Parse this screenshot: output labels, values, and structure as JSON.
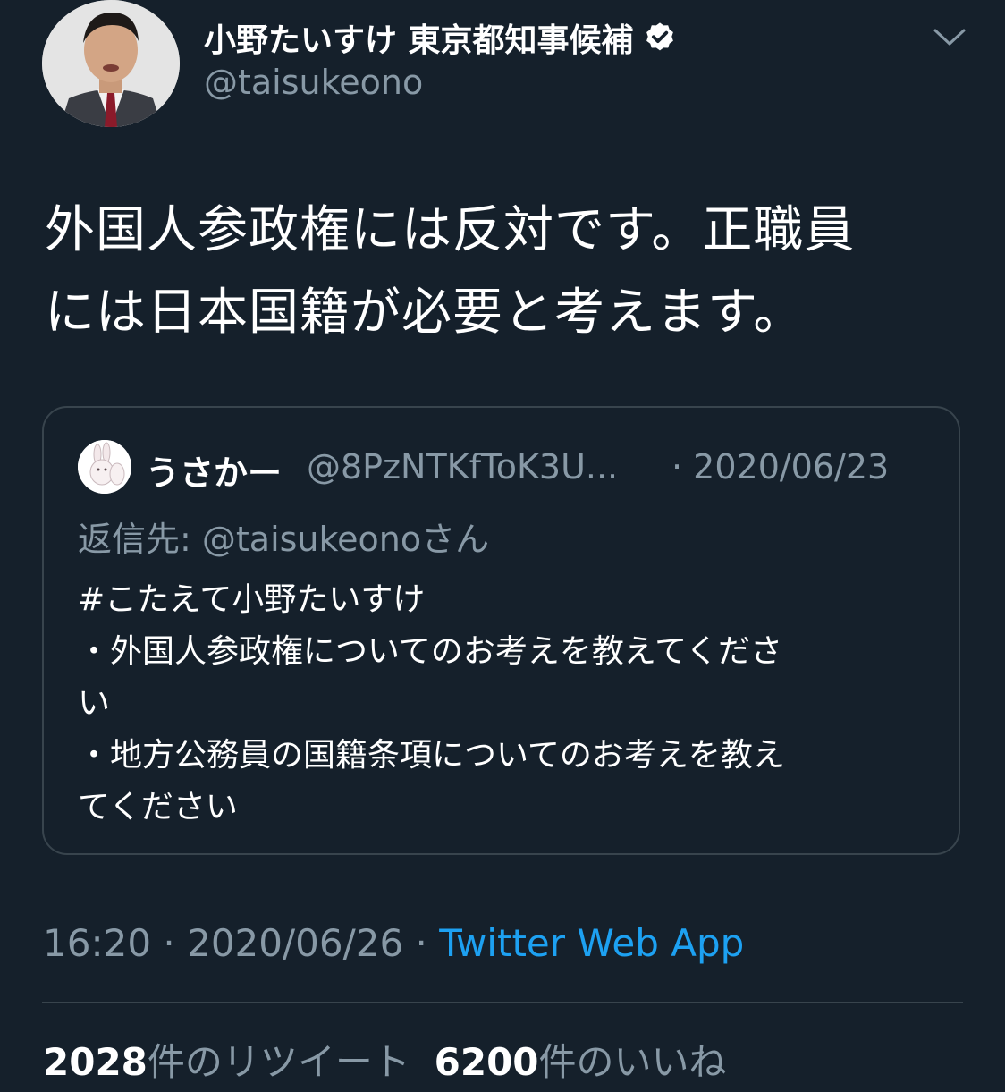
{
  "author": {
    "display_name": "小野たいすけ 東京都知事候補",
    "handle": "@taisukeono",
    "verified_icon": "verified-badge-icon"
  },
  "tweet": {
    "text_lines": [
      "外国人参政権には反対です。正職員",
      "には日本国籍が必要と考えます。"
    ]
  },
  "quoted_tweet": {
    "display_name": "うさかー",
    "handle": "@8PzNTKfToK3U...",
    "date": "· 2020/06/23",
    "reply_to": "返信先: @taisukeonoさん",
    "body_lines": [
      "#こたえて小野たいすけ",
      "・外国人参政権についてのお考えを教えてくださ",
      "い",
      "・地方公務員の国籍条項についてのお考えを教え",
      "てください"
    ]
  },
  "meta": {
    "time": "16:20",
    "separator1": " · ",
    "date": "2020/06/26",
    "separator2": " · ",
    "source": "Twitter Web App"
  },
  "stats": {
    "retweet_count": "2028",
    "retweet_label": "件のリツイート",
    "like_count": "6200",
    "like_label": "件のいいね"
  },
  "colors": {
    "background": "#15202b",
    "secondary_text": "#8899a6",
    "accent": "#1da1f2",
    "border": "#38444d"
  }
}
